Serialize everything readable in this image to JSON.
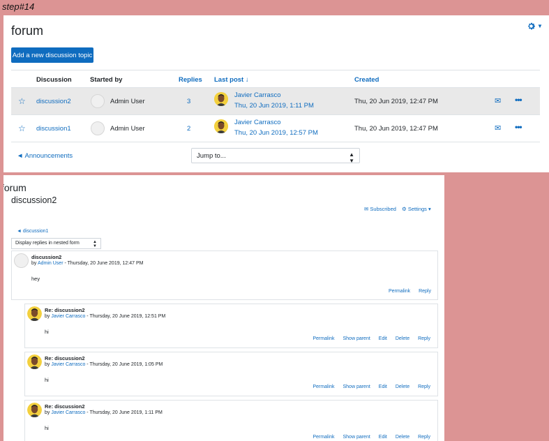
{
  "step_label": "step#14",
  "forum": {
    "title": "forum",
    "add_button": "Add a new discussion topic",
    "columns": {
      "discussion": "Discussion",
      "started_by": "Started by",
      "replies": "Replies",
      "last_post": "Last post ↓",
      "created": "Created"
    },
    "rows": [
      {
        "name": "discussion2",
        "started_by": "Admin User",
        "replies": "3",
        "last_user": "Javier Carrasco",
        "last_date": "Thu, 20 Jun 2019, 1:11 PM",
        "created": "Thu, 20 Jun 2019, 12:47 PM"
      },
      {
        "name": "discussion1",
        "started_by": "Admin User",
        "replies": "2",
        "last_user": "Javier Carrasco",
        "last_date": "Thu, 20 Jun 2019, 12:57 PM",
        "created": "Thu, 20 Jun 2019, 12:47 PM"
      }
    ],
    "announcements_link": "◄ Announcements",
    "jump_to": "Jump to..."
  },
  "discussion": {
    "forum_title": "forum",
    "title": "discussion2",
    "subscribed": "Subscribed",
    "settings": "Settings",
    "prev_link": "◄ discussion1",
    "display_mode": "Display replies in nested form",
    "posts": [
      {
        "subject": "discussion2",
        "by_prefix": "by ",
        "author": "Admin User",
        "date": " - Thursday, 20 June 2019, 12:47 PM",
        "message": "hey",
        "commands": [
          "Permalink",
          "Reply"
        ]
      },
      {
        "subject": "Re: discussion2",
        "by_prefix": "by ",
        "author": "Javier Carrasco",
        "date": " - Thursday, 20 June 2019, 12:51 PM",
        "message": "hi",
        "commands": [
          "Permalink",
          "Show parent",
          "Edit",
          "Delete",
          "Reply"
        ]
      },
      {
        "subject": "Re: discussion2",
        "by_prefix": "by ",
        "author": "Javier Carrasco",
        "date": " - Thursday, 20 June 2019, 1:05 PM",
        "message": "hi",
        "commands": [
          "Permalink",
          "Show parent",
          "Edit",
          "Delete",
          "Reply"
        ]
      },
      {
        "subject": "Re: discussion2",
        "by_prefix": "by ",
        "author": "Javier Carrasco",
        "date": " - Thursday, 20 June 2019, 1:11 PM",
        "message": "hi",
        "commands": [
          "Permalink",
          "Show parent",
          "Edit",
          "Delete",
          "Reply"
        ]
      }
    ]
  },
  "colors": {
    "accent": "#0f6cbf",
    "background": "#dc9494",
    "row_highlight": "#e9e9e9"
  },
  "icons": [
    "gear-icon",
    "star-icon",
    "mail-icon",
    "more-icon",
    "sort-arrow-icon"
  ]
}
